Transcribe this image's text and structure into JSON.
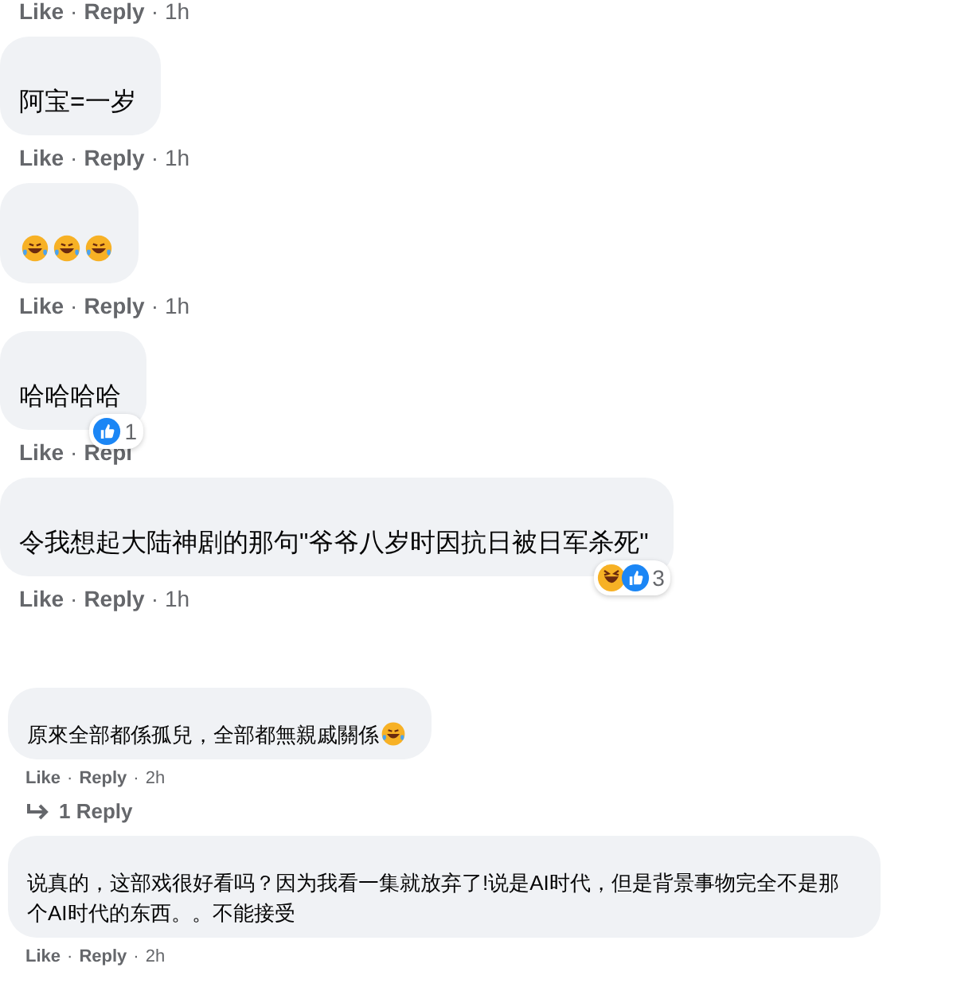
{
  "top_actions": {
    "like": "Like",
    "separator": "·",
    "reply": "Reply",
    "time": "1h"
  },
  "comments": [
    {
      "kind": "large",
      "text": "阿宝=一岁",
      "actions": {
        "like": "Like",
        "separator": "·",
        "reply": "Reply",
        "time": "1h"
      }
    },
    {
      "kind": "large",
      "emojis": [
        {
          "kind": "tears-of-joy"
        },
        {
          "kind": "tears-of-joy"
        },
        {
          "kind": "tears-of-joy"
        }
      ],
      "actions": {
        "like": "Like",
        "separator": "·",
        "reply": "Reply",
        "time": "1h"
      }
    },
    {
      "kind": "large",
      "text": "哈哈哈哈",
      "reactions": {
        "icons": [
          {
            "kind": "like"
          }
        ],
        "count": "1"
      },
      "actions": {
        "like": "Like",
        "separator": "·",
        "reply": "Repl"
      }
    },
    {
      "kind": "large",
      "text": "令我想起大陆神剧的那句\"爷爷八岁时因抗日被日军杀死\"",
      "reactions": {
        "icons": [
          {
            "kind": "haha"
          },
          {
            "kind": "like"
          }
        ],
        "count": "3"
      },
      "actions": {
        "like": "Like",
        "separator": "·",
        "reply": "Reply",
        "time": "1h"
      }
    },
    {
      "kind": "compact",
      "text": "原來全部都係孤兒，全部都無親戚關係",
      "emojis": [
        {
          "kind": "tears-of-joy"
        }
      ],
      "actions": {
        "like": "Like",
        "separator": "·",
        "reply": "Reply",
        "time": "2h"
      },
      "replies_link": "1 Reply"
    },
    {
      "kind": "compact",
      "text": "说真的，这部戏很好看吗？因为我看一集就放弃了!说是AI时代，但是背景事物完全不是那个AI时代的东西。。不能接受",
      "actions": {
        "like": "Like",
        "separator": "·",
        "reply": "Reply",
        "time": "2h"
      }
    }
  ]
}
